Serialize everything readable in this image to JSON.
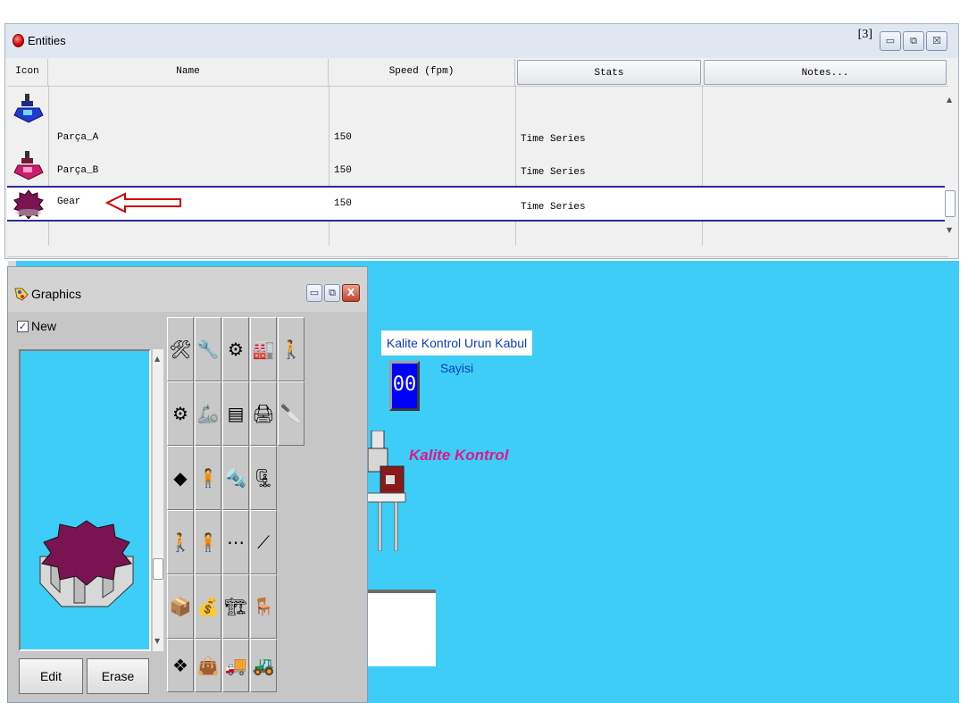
{
  "entities_window": {
    "title": "Entities",
    "count": "[3]",
    "controls": {
      "minimize": "▭",
      "restore": "⧉",
      "close": "☒"
    },
    "columns": [
      "Icon",
      "Name",
      "Speed (fpm)",
      "Stats",
      "Notes..."
    ],
    "rows": [
      {
        "name": "Parça_A",
        "speed": "150",
        "stats": "Time Series",
        "notes": ""
      },
      {
        "name": "Parça_B",
        "speed": "150",
        "stats": "Time Series",
        "notes": ""
      },
      {
        "name": "Gear",
        "speed": "150",
        "stats": "Time Series",
        "notes": ""
      }
    ],
    "selected_row": 2,
    "arrow_color": "#d40000"
  },
  "graphics_window": {
    "title": "Graphics",
    "new_label": "New",
    "new_checked": true,
    "edit_label": "Edit",
    "erase_label": "Erase",
    "controls": {
      "minimize": "▭",
      "restore": "⧉",
      "close": "X"
    }
  },
  "canvas": {
    "background": "#3ecdf7",
    "counter_label": "Kalite Kontrol Urun Kabul Sayisi",
    "counter_value": "00",
    "station_label": "Kalite Kontrol"
  }
}
